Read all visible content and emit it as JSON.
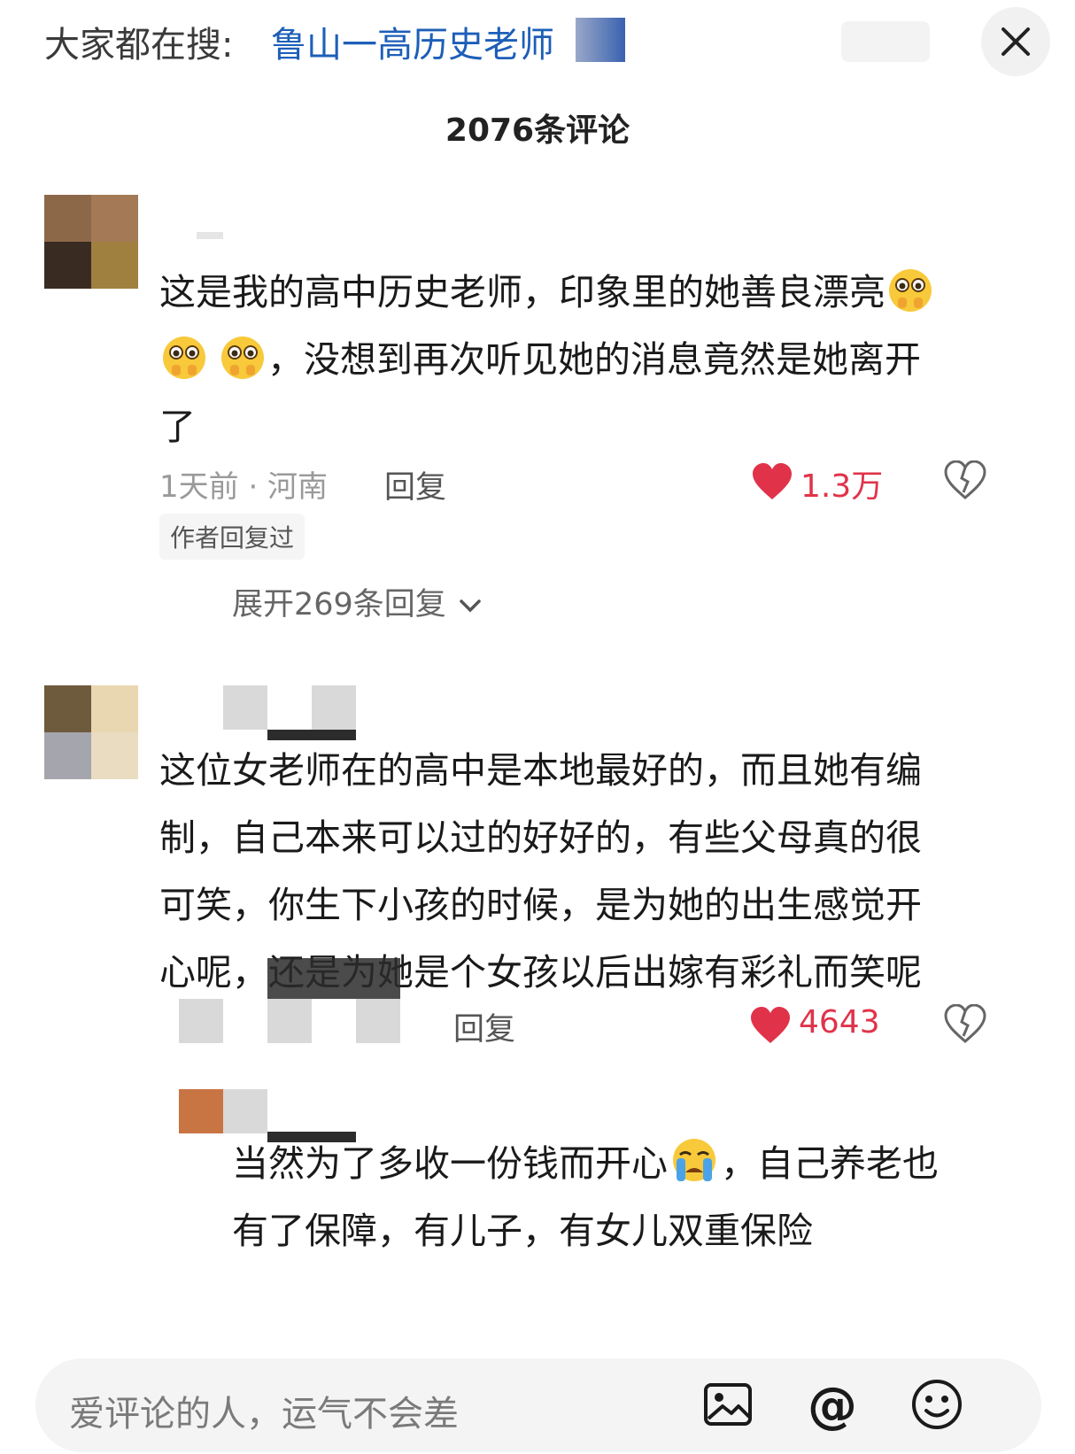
{
  "search": {
    "prefix": "大家都在搜:",
    "term": "鲁山一高历史老师",
    "close_icon": "close-icon"
  },
  "comments_header": {
    "title": "2076条评论"
  },
  "comments": [
    {
      "text_line1": "这是我的高中历史老师，印象里的她善良漂亮",
      "text_line2": "，没想到再次听见她的消息竟然是她离开",
      "text_line3": "了",
      "meta": "1天前 · 河南",
      "reply_label": "回复",
      "likes": "1.3万",
      "author_badge": "作者回复过",
      "expand_replies": "展开269条回复"
    },
    {
      "text_line1": "这位女老师在的高中是本地最好的，而且她有编",
      "text_line2": "制，自己本来可以过的好好的，有些父母真的很",
      "text_line3": "可笑，你生下小孩的时候，是为她的出生感觉开",
      "text_line4": "心呢，还是为她是个女孩以后出嫁有彩礼而笑呢",
      "reply_label": "回复",
      "likes": "4643"
    }
  ],
  "reply": {
    "text_line1a": "当然为了多收一份钱而开心",
    "text_line1b": "，自己养老也",
    "text_line2": "有了保障，有儿子，有女儿双重保险"
  },
  "input": {
    "placeholder": "爱评论的人，运气不会差",
    "image_icon": "image-icon",
    "at_icon": "at-icon",
    "emoji_icon": "emoji-icon"
  },
  "colors": {
    "link_blue": "#1d5fb8",
    "like_red": "#e0334a",
    "text": "#1a1a1a",
    "meta_gray": "#9a9a9a"
  }
}
